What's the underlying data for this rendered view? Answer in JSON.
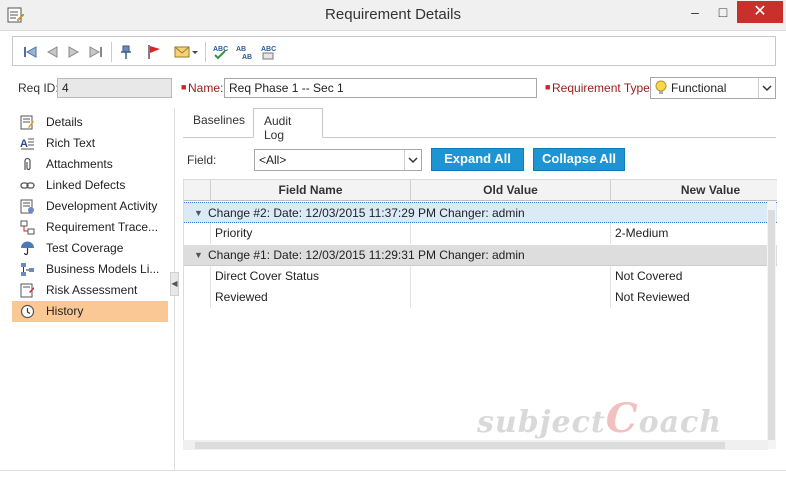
{
  "window": {
    "title": "Requirement Details",
    "minimize": "–",
    "maximize": "□",
    "close": "✕"
  },
  "toolbar": {
    "icons": [
      "first-record-icon",
      "previous-record-icon",
      "next-record-icon",
      "last-record-icon",
      "pin-icon",
      "flag-icon",
      "send-mail-icon",
      "spell-check-icon",
      "thesaurus-icon",
      "spelling-options-icon"
    ]
  },
  "header": {
    "req_id_label": "Req ID:",
    "req_id_value": "4",
    "name_label": "Name:",
    "name_value": "Req Phase 1 -- Sec 1",
    "type_label": "Requirement Type:",
    "type_value": "Functional"
  },
  "sidebar": {
    "items": [
      {
        "label": "Details",
        "icon": "details-icon"
      },
      {
        "label": "Rich Text",
        "icon": "rich-text-icon"
      },
      {
        "label": "Attachments",
        "icon": "paperclip-icon"
      },
      {
        "label": "Linked Defects",
        "icon": "link-icon"
      },
      {
        "label": "Development Activity",
        "icon": "development-icon"
      },
      {
        "label": "Requirement Trace...",
        "icon": "trace-icon"
      },
      {
        "label": "Test Coverage",
        "icon": "umbrella-icon"
      },
      {
        "label": "Business Models Li...",
        "icon": "business-model-icon"
      },
      {
        "label": "Risk Assessment",
        "icon": "risk-icon"
      },
      {
        "label": "History",
        "icon": "history-icon"
      }
    ],
    "active": "History"
  },
  "tabs": [
    {
      "label": "Baselines"
    },
    {
      "label": "Audit Log"
    }
  ],
  "filter": {
    "field_label": "Field:",
    "field_value": "<All>",
    "expand_label": "Expand All",
    "collapse_label": "Collapse All"
  },
  "grid": {
    "columns": [
      "Field Name",
      "Old Value",
      "New Value"
    ],
    "groups": [
      {
        "header": "Change #2: Date: 12/03/2015 11:37:29 PM  Changer: admin",
        "rows": [
          {
            "field": "Priority",
            "old": "",
            "new": "2-Medium"
          }
        ]
      },
      {
        "header": "Change #1: Date: 12/03/2015 11:29:31 PM  Changer: admin",
        "rows": [
          {
            "field": "Direct Cover Status",
            "old": "",
            "new": "Not Covered"
          },
          {
            "field": "Reviewed",
            "old": "",
            "new": "Not Reviewed"
          }
        ]
      }
    ]
  },
  "watermark": {
    "text1": "subject",
    "text2": "C",
    "text3": "oach"
  },
  "colors": {
    "accent_blue": "#1e94d2",
    "active_item": "#fac894",
    "close_red": "#c9302c"
  }
}
